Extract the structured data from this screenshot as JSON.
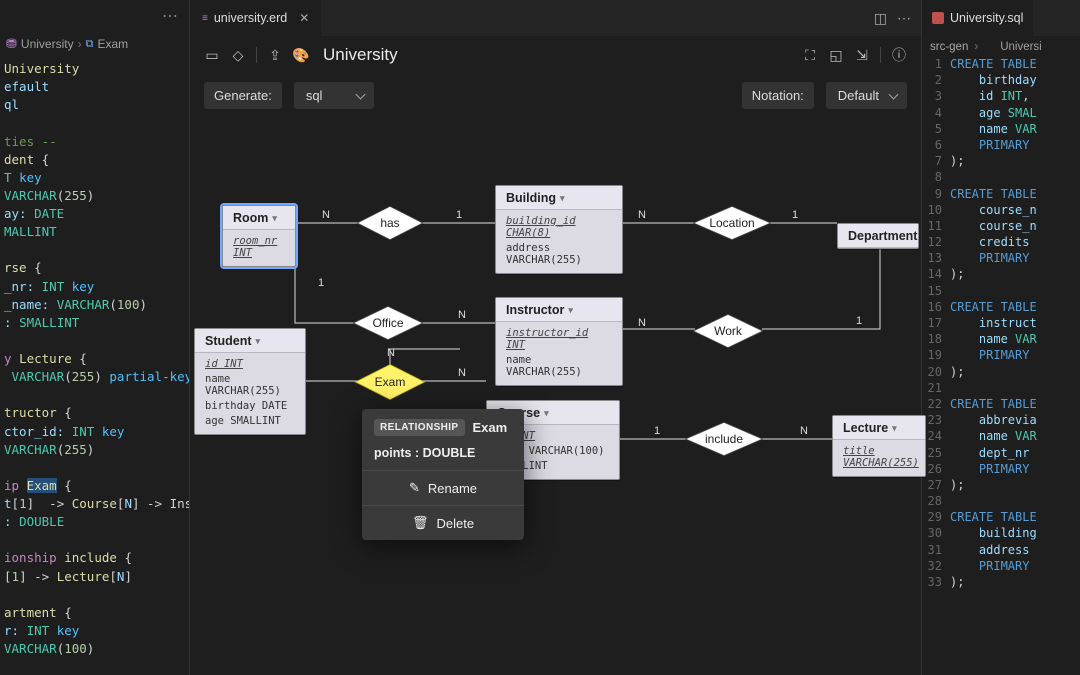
{
  "left": {
    "breadcrumb": {
      "parent": "University",
      "child": "Exam"
    },
    "lines": [
      {
        "segs": [
          {
            "t": "University",
            "c": "t-name"
          }
        ]
      },
      {
        "segs": [
          {
            "t": "efault",
            "c": "t-ident"
          }
        ]
      },
      {
        "segs": [
          {
            "t": "ql",
            "c": "t-ident"
          }
        ]
      },
      {
        "segs": []
      },
      {
        "segs": [
          {
            "t": "ties --",
            "c": "t-comment"
          }
        ]
      },
      {
        "segs": [
          {
            "t": "dent ",
            "c": "t-name"
          },
          {
            "t": "{",
            "c": "t-punct"
          }
        ]
      },
      {
        "segs": [
          {
            "t": "T ",
            "c": "t-type"
          },
          {
            "t": "key",
            "c": "t-modifier"
          }
        ]
      },
      {
        "segs": [
          {
            "t": "VARCHAR",
            "c": "t-type"
          },
          {
            "t": "(",
            "c": "t-punct"
          },
          {
            "t": "255",
            "c": "t-num"
          },
          {
            "t": ")",
            "c": "t-punct"
          }
        ]
      },
      {
        "segs": [
          {
            "t": "ay: ",
            "c": "t-ident"
          },
          {
            "t": "DATE",
            "c": "t-type"
          }
        ]
      },
      {
        "segs": [
          {
            "t": "MALLINT",
            "c": "t-type"
          }
        ]
      },
      {
        "segs": []
      },
      {
        "segs": [
          {
            "t": "rse ",
            "c": "t-name"
          },
          {
            "t": "{",
            "c": "t-punct"
          }
        ]
      },
      {
        "segs": [
          {
            "t": "_nr: ",
            "c": "t-ident"
          },
          {
            "t": "INT ",
            "c": "t-type"
          },
          {
            "t": "key",
            "c": "t-modifier"
          }
        ]
      },
      {
        "segs": [
          {
            "t": "_name: ",
            "c": "t-ident"
          },
          {
            "t": "VARCHAR",
            "c": "t-type"
          },
          {
            "t": "(",
            "c": "t-punct"
          },
          {
            "t": "100",
            "c": "t-num"
          },
          {
            "t": ")",
            "c": "t-punct"
          }
        ]
      },
      {
        "segs": [
          {
            "t": ": ",
            "c": "t-ident"
          },
          {
            "t": "SMALLINT",
            "c": "t-type"
          }
        ]
      },
      {
        "segs": []
      },
      {
        "segs": [
          {
            "t": "y ",
            "c": "t-kw"
          },
          {
            "t": "Lecture ",
            "c": "t-name"
          },
          {
            "t": "{",
            "c": "t-punct"
          }
        ]
      },
      {
        "segs": [
          {
            "t": " VARCHAR",
            "c": "t-type"
          },
          {
            "t": "(",
            "c": "t-punct"
          },
          {
            "t": "255",
            "c": "t-num"
          },
          {
            "t": ") ",
            "c": "t-punct"
          },
          {
            "t": "partial-key",
            "c": "t-modifier"
          }
        ]
      },
      {
        "segs": []
      },
      {
        "segs": [
          {
            "t": "tructor ",
            "c": "t-name"
          },
          {
            "t": "{",
            "c": "t-punct"
          }
        ]
      },
      {
        "segs": [
          {
            "t": "ctor_id: ",
            "c": "t-ident"
          },
          {
            "t": "INT ",
            "c": "t-type"
          },
          {
            "t": "key",
            "c": "t-modifier"
          }
        ]
      },
      {
        "segs": [
          {
            "t": "VARCHAR",
            "c": "t-type"
          },
          {
            "t": "(",
            "c": "t-punct"
          },
          {
            "t": "255",
            "c": "t-num"
          },
          {
            "t": ")",
            "c": "t-punct"
          }
        ]
      },
      {
        "segs": []
      },
      {
        "segs": [
          {
            "t": "ip ",
            "c": "t-kw"
          },
          {
            "t": "Exam",
            "c": "t-name t-sel"
          },
          {
            "t": " {",
            "c": "t-punct"
          }
        ]
      },
      {
        "segs": [
          {
            "t": "t",
            "c": "t-ident"
          },
          {
            "t": "[",
            "c": "t-punct"
          },
          {
            "t": "1",
            "c": "t-num"
          },
          {
            "t": "]  -> ",
            "c": "t-punct"
          },
          {
            "t": "Course",
            "c": "t-name"
          },
          {
            "t": "[",
            "c": "t-punct"
          },
          {
            "t": "N",
            "c": "t-ident"
          },
          {
            "t": "] -> Ins",
            "c": "t-punct"
          }
        ]
      },
      {
        "segs": [
          {
            "t": ": ",
            "c": "t-ident"
          },
          {
            "t": "DOUBLE",
            "c": "t-type"
          }
        ]
      },
      {
        "segs": []
      },
      {
        "segs": [
          {
            "t": "ionship ",
            "c": "t-kw"
          },
          {
            "t": "include ",
            "c": "t-name"
          },
          {
            "t": "{",
            "c": "t-punct"
          }
        ]
      },
      {
        "segs": [
          {
            "t": "[",
            "c": "t-punct"
          },
          {
            "t": "1",
            "c": "t-num"
          },
          {
            "t": "] -> ",
            "c": "t-punct"
          },
          {
            "t": "Lecture",
            "c": "t-name"
          },
          {
            "t": "[",
            "c": "t-punct"
          },
          {
            "t": "N",
            "c": "t-ident"
          },
          {
            "t": "]",
            "c": "t-punct"
          }
        ]
      },
      {
        "segs": []
      },
      {
        "segs": [
          {
            "t": "artment ",
            "c": "t-name"
          },
          {
            "t": "{",
            "c": "t-punct"
          }
        ]
      },
      {
        "segs": [
          {
            "t": "r: ",
            "c": "t-ident"
          },
          {
            "t": "INT ",
            "c": "t-type"
          },
          {
            "t": "key",
            "c": "t-modifier"
          }
        ]
      },
      {
        "segs": [
          {
            "t": "VARCHAR",
            "c": "t-type"
          },
          {
            "t": "(",
            "c": "t-punct"
          },
          {
            "t": "100",
            "c": "t-num"
          },
          {
            "t": ")",
            "c": "t-punct"
          }
        ]
      }
    ]
  },
  "center": {
    "tab_title": "university.erd",
    "title": "University",
    "generate_label": "Generate:",
    "generate_value": "sql",
    "notation_label": "Notation:",
    "notation_value": "Default",
    "entities": {
      "room": {
        "name": "Room",
        "attrs": [
          {
            "key": true,
            "txt": "room_nr  INT"
          }
        ]
      },
      "building": {
        "name": "Building",
        "attrs": [
          {
            "key": true,
            "txt": "building_id  CHAR(8)"
          },
          {
            "key": false,
            "txt": "address  VARCHAR(255)"
          }
        ]
      },
      "department": {
        "name": "Department",
        "attrs": []
      },
      "student": {
        "name": "Student",
        "attrs": [
          {
            "key": true,
            "txt": "id  INT"
          },
          {
            "key": false,
            "txt": "name  VARCHAR(255)"
          },
          {
            "key": false,
            "txt": "birthday  DATE"
          },
          {
            "key": false,
            "txt": "age  SMALLINT"
          }
        ]
      },
      "instructor": {
        "name": "Instructor",
        "attrs": [
          {
            "key": true,
            "txt": "instructor_id  INT"
          },
          {
            "key": false,
            "txt": "name  VARCHAR(255)"
          }
        ]
      },
      "course": {
        "name": "Course",
        "attrs": [
          {
            "key": true,
            "txt": "nr  INT"
          },
          {
            "key": false,
            "txt": "name  VARCHAR(100)"
          },
          {
            "key": false,
            "txt": "SMALLINT"
          }
        ]
      },
      "lecture": {
        "name": "Lecture",
        "attrs": [
          {
            "key": true,
            "txt": "title  VARCHAR(255)"
          }
        ]
      }
    },
    "rels": {
      "has": "has",
      "location": "Location",
      "office": "Office",
      "work": "Work",
      "exam": "Exam",
      "include": "include"
    },
    "cards": {
      "has_l": "N",
      "has_r": "1",
      "loc_l": "N",
      "loc_r": "1",
      "off_top": "1",
      "off_bot": "N",
      "work_l": "N",
      "work_r": "1",
      "inc_l": "1",
      "inc_r": "N",
      "exam_top": "N",
      "exam_right": "N"
    },
    "popover": {
      "pill": "RELATIONSHIP",
      "name": "Exam",
      "attr": "points : DOUBLE",
      "rename": "Rename",
      "delete": "Delete"
    }
  },
  "right": {
    "tab_title": "University.sql",
    "breadcrumb_folder": "src-gen",
    "breadcrumb_file": "Universi",
    "lines": [
      {
        "n": 1,
        "segs": [
          {
            "t": "CREATE TABLE",
            "c": "sk-kw"
          }
        ]
      },
      {
        "n": 2,
        "segs": [
          {
            "t": "    birthday",
            "c": "sk-ident"
          }
        ]
      },
      {
        "n": 3,
        "segs": [
          {
            "t": "    id ",
            "c": "sk-ident"
          },
          {
            "t": "INT",
            "c": "sk-type"
          },
          {
            "t": ",",
            "c": "sk-pl"
          }
        ]
      },
      {
        "n": 4,
        "segs": [
          {
            "t": "    age ",
            "c": "sk-ident"
          },
          {
            "t": "SMAL",
            "c": "sk-type"
          }
        ]
      },
      {
        "n": 5,
        "segs": [
          {
            "t": "    name ",
            "c": "sk-ident"
          },
          {
            "t": "VAR",
            "c": "sk-type"
          }
        ]
      },
      {
        "n": 6,
        "segs": [
          {
            "t": "    ",
            "c": ""
          },
          {
            "t": "PRIMARY",
            "c": "sk-kw"
          }
        ]
      },
      {
        "n": 7,
        "segs": [
          {
            "t": ");",
            "c": "sk-pl"
          }
        ]
      },
      {
        "n": 8,
        "segs": []
      },
      {
        "n": 9,
        "segs": [
          {
            "t": "CREATE TABLE",
            "c": "sk-kw"
          }
        ]
      },
      {
        "n": 10,
        "segs": [
          {
            "t": "    course_n",
            "c": "sk-ident"
          }
        ]
      },
      {
        "n": 11,
        "segs": [
          {
            "t": "    course_n",
            "c": "sk-ident"
          }
        ]
      },
      {
        "n": 12,
        "segs": [
          {
            "t": "    credits",
            "c": "sk-ident"
          }
        ]
      },
      {
        "n": 13,
        "segs": [
          {
            "t": "    ",
            "c": ""
          },
          {
            "t": "PRIMARY",
            "c": "sk-kw"
          }
        ]
      },
      {
        "n": 14,
        "segs": [
          {
            "t": ");",
            "c": "sk-pl"
          }
        ]
      },
      {
        "n": 15,
        "segs": []
      },
      {
        "n": 16,
        "segs": [
          {
            "t": "CREATE TABLE",
            "c": "sk-kw"
          }
        ]
      },
      {
        "n": 17,
        "segs": [
          {
            "t": "    instruct",
            "c": "sk-ident"
          }
        ]
      },
      {
        "n": 18,
        "segs": [
          {
            "t": "    name ",
            "c": "sk-ident"
          },
          {
            "t": "VAR",
            "c": "sk-type"
          }
        ]
      },
      {
        "n": 19,
        "segs": [
          {
            "t": "    ",
            "c": ""
          },
          {
            "t": "PRIMARY",
            "c": "sk-kw"
          }
        ]
      },
      {
        "n": 20,
        "segs": [
          {
            "t": ");",
            "c": "sk-pl"
          }
        ]
      },
      {
        "n": 21,
        "segs": []
      },
      {
        "n": 22,
        "segs": [
          {
            "t": "CREATE TABLE",
            "c": "sk-kw"
          }
        ]
      },
      {
        "n": 23,
        "segs": [
          {
            "t": "    abbrevia",
            "c": "sk-ident"
          }
        ]
      },
      {
        "n": 24,
        "segs": [
          {
            "t": "    name ",
            "c": "sk-ident"
          },
          {
            "t": "VAR",
            "c": "sk-type"
          }
        ]
      },
      {
        "n": 25,
        "segs": [
          {
            "t": "    dept_nr",
            "c": "sk-ident"
          }
        ]
      },
      {
        "n": 26,
        "segs": [
          {
            "t": "    ",
            "c": ""
          },
          {
            "t": "PRIMARY",
            "c": "sk-kw"
          }
        ]
      },
      {
        "n": 27,
        "segs": [
          {
            "t": ");",
            "c": "sk-pl"
          }
        ]
      },
      {
        "n": 28,
        "segs": []
      },
      {
        "n": 29,
        "segs": [
          {
            "t": "CREATE TABLE",
            "c": "sk-kw"
          }
        ]
      },
      {
        "n": 30,
        "segs": [
          {
            "t": "    building",
            "c": "sk-ident"
          }
        ]
      },
      {
        "n": 31,
        "segs": [
          {
            "t": "    address",
            "c": "sk-ident"
          }
        ]
      },
      {
        "n": 32,
        "segs": [
          {
            "t": "    ",
            "c": ""
          },
          {
            "t": "PRIMARY",
            "c": "sk-kw"
          }
        ]
      },
      {
        "n": 33,
        "segs": [
          {
            "t": ");",
            "c": "sk-pl"
          }
        ]
      }
    ]
  }
}
